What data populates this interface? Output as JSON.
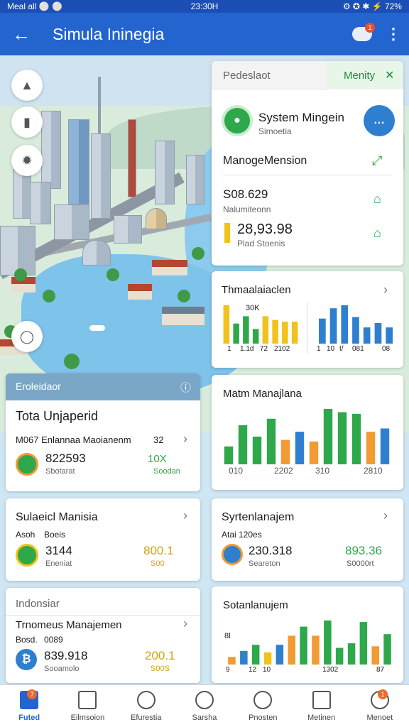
{
  "status_bar": {
    "left": "Meal all ⚪ ⚪",
    "time": "23:30H",
    "right": "⚙ ✪ ✱ ⚡ 72%"
  },
  "header": {
    "title": "Simula Ininegia",
    "notification_count": "1"
  },
  "map_buttons": [
    "compass-icon",
    "lock-icon",
    "sun-icon",
    "globe-icon"
  ],
  "panel_top": {
    "tab_left": "Pedeslaot",
    "tab_right": "Menity",
    "system_title": "System Mingein",
    "system_sub": "Simoetia",
    "manage_title": "ManogeMension",
    "stat1_value": "S08.629",
    "stat1_label": "Nalumiteonn",
    "stat2_value": "28,93.98",
    "stat2_label": "Plad Stoenis"
  },
  "chart_card_1": {
    "title": "Thmaalaiaclen",
    "annotation": "30K",
    "tick_labels_left": [
      "1",
      "1.1d",
      "72",
      "2102"
    ],
    "tick_labels_right": [
      "1",
      "10",
      "t/",
      "081",
      "08"
    ]
  },
  "chart_card_2": {
    "title": "Matm Manajlana",
    "tick_labels": [
      "010",
      "2202",
      "310",
      "2810"
    ]
  },
  "card_total": {
    "header": "Eroleidaor",
    "title": "Tota Unjaperid",
    "row_label": "M067  Enlannaa Maoianenm",
    "row_right": "32",
    "value": "822593",
    "value_sub": "Sbotarat",
    "right_value": "10X",
    "right_sub": "Soodan"
  },
  "card_sulaeicl": {
    "title": "Sulaeicl Manisia",
    "sub_left": "Asoh",
    "sub_right": "Boeis",
    "value": "3144",
    "value_sub": "Eneniat",
    "right_value": "800.1",
    "right_sub": "S00"
  },
  "card_syrtenlanajem": {
    "title": "Syrtenlanajem",
    "sub": "Atai 120es",
    "value": "230.318",
    "value_sub": "Seareton",
    "right_value": "893.36",
    "right_sub": "S0000rt"
  },
  "card_indonsiar": {
    "header": "Indonsiar",
    "title": "Trnomeus Manajemen",
    "sub_left": "Bosd.",
    "sub_right": "0089",
    "value": "839.918",
    "value_sub": "Sooamolo",
    "right_value": "200.1",
    "right_sub": "S00S"
  },
  "chart_card_3": {
    "title": "Sotanlanujem",
    "annotation": "8l",
    "tick_labels": [
      "9",
      "12",
      "10",
      "1302",
      "87"
    ]
  },
  "bottom_nav": [
    {
      "label": "Futed",
      "icon": "home-icon",
      "badge": "7"
    },
    {
      "label": "Eilmsoion",
      "icon": "calendar-icon"
    },
    {
      "label": "Efurestia",
      "icon": "leaf-icon"
    },
    {
      "label": "Sarsha",
      "icon": "circle-icon"
    },
    {
      "label": "Pnosten",
      "icon": "globe-icon"
    },
    {
      "label": "Metinen",
      "icon": "monitor-icon"
    },
    {
      "label": "Menoet",
      "icon": "profile-icon",
      "badge": "1"
    }
  ],
  "colors": {
    "primary": "#2464cf",
    "green": "#2ea84a",
    "yellow": "#f0c21b",
    "orange": "#f29a33",
    "blue": "#2f7fd0"
  },
  "chart_data": [
    {
      "type": "bar",
      "name": "Thmaalaiaclen-left",
      "values": [
        42,
        22,
        30,
        16,
        30,
        26,
        24,
        24
      ],
      "colors": [
        "#f0c21b",
        "#2ea84a",
        "#2ea84a",
        "#2ea84a",
        "#f0c21b",
        "#f0c21b",
        "#f0c21b",
        "#f0c21b"
      ]
    },
    {
      "type": "bar",
      "name": "Thmaalaiaclen-right",
      "values": [
        34,
        48,
        52,
        36,
        22,
        28,
        22
      ],
      "colors": [
        "#2f7fd0",
        "#2f7fd0",
        "#2f7fd0",
        "#2f7fd0",
        "#2f7fd0",
        "#2f7fd0",
        "#2f7fd0"
      ]
    },
    {
      "type": "bar",
      "name": "Matm Manajlana",
      "values": [
        22,
        48,
        34,
        56,
        30,
        40,
        28,
        68,
        64,
        62,
        40,
        44
      ],
      "colors": [
        "#2ea84a",
        "#2ea84a",
        "#2ea84a",
        "#2ea84a",
        "#f29a33",
        "#2f7fd0",
        "#f29a33",
        "#2ea84a",
        "#2ea84a",
        "#2ea84a",
        "#f29a33",
        "#2f7fd0"
      ]
    },
    {
      "type": "bar",
      "name": "Sotanlanujem",
      "values": [
        10,
        18,
        26,
        16,
        26,
        38,
        50,
        38,
        58,
        22,
        28,
        56,
        24,
        40
      ],
      "colors": [
        "#f29a33",
        "#2f7fd0",
        "#2ea84a",
        "#f0c21b",
        "#2f7fd0",
        "#f29a33",
        "#2ea84a",
        "#f29a33",
        "#2ea84a",
        "#2ea84a",
        "#2ea84a",
        "#2ea84a",
        "#f29a33",
        "#2ea84a"
      ]
    }
  ]
}
